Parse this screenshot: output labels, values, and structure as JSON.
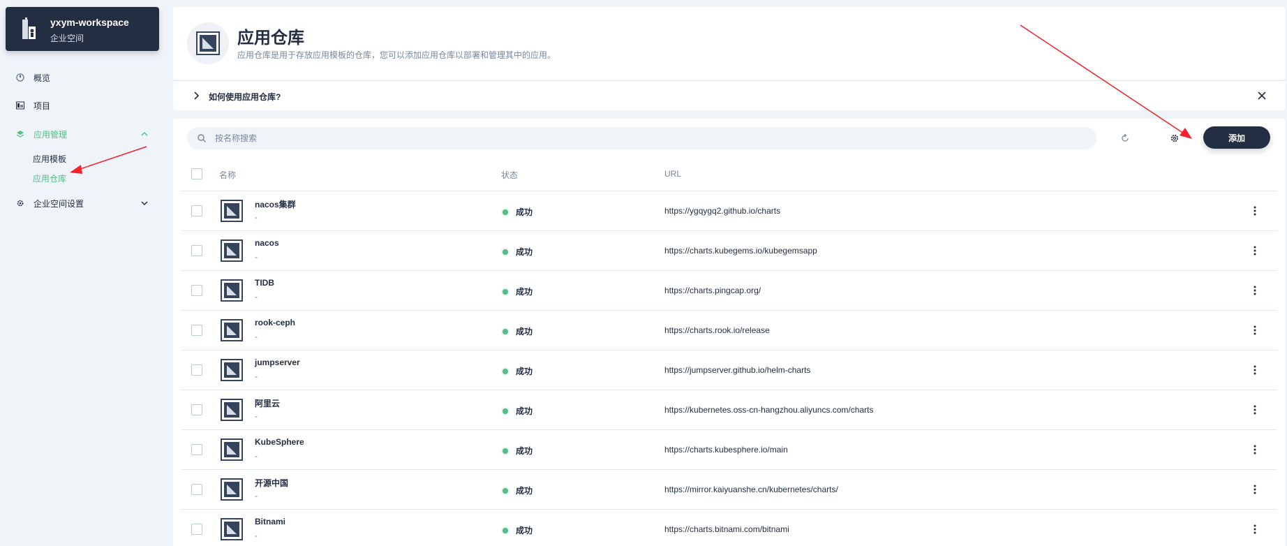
{
  "workspace": {
    "name": "yxym-workspace",
    "type": "企业空间"
  },
  "nav": {
    "overview": "概览",
    "projects": "项目",
    "app_management": "应用管理",
    "app_templates": "应用模板",
    "app_repos": "应用仓库",
    "ws_settings": "企业空间设置"
  },
  "header": {
    "title": "应用仓库",
    "description": "应用仓库是用于存放应用模板的仓库，您可以添加应用仓库以部署和管理其中的应用。"
  },
  "help": {
    "text": "如何使用应用仓库?"
  },
  "toolbar": {
    "search_placeholder": "按名称搜索",
    "add_label": "添加"
  },
  "table": {
    "columns": {
      "name": "名称",
      "status": "状态",
      "url": "URL"
    },
    "rows": [
      {
        "name": "nacos集群",
        "desc": "-",
        "status": "成功",
        "url": "https://ygqygq2.github.io/charts"
      },
      {
        "name": "nacos",
        "desc": "-",
        "status": "成功",
        "url": "https://charts.kubegems.io/kubegemsapp"
      },
      {
        "name": "TIDB",
        "desc": "-",
        "status": "成功",
        "url": "https://charts.pingcap.org/"
      },
      {
        "name": "rook-ceph",
        "desc": "-",
        "status": "成功",
        "url": "https://charts.rook.io/release"
      },
      {
        "name": "jumpserver",
        "desc": "-",
        "status": "成功",
        "url": "https://jumpserver.github.io/helm-charts"
      },
      {
        "name": "阿里云",
        "desc": "-",
        "status": "成功",
        "url": "https://kubernetes.oss-cn-hangzhou.aliyuncs.com/charts"
      },
      {
        "name": "KubeSphere",
        "desc": "-",
        "status": "成功",
        "url": "https://charts.kubesphere.io/main"
      },
      {
        "name": "开源中国",
        "desc": "-",
        "status": "成功",
        "url": "https://mirror.kaiyuanshe.cn/kubernetes/charts/"
      },
      {
        "name": "Bitnami",
        "desc": "-",
        "status": "成功",
        "url": "https://charts.bitnami.com/bitnami"
      }
    ]
  },
  "colors": {
    "accent": "#55bc8a",
    "dark": "#242e42",
    "annotation": "#f5222d"
  }
}
